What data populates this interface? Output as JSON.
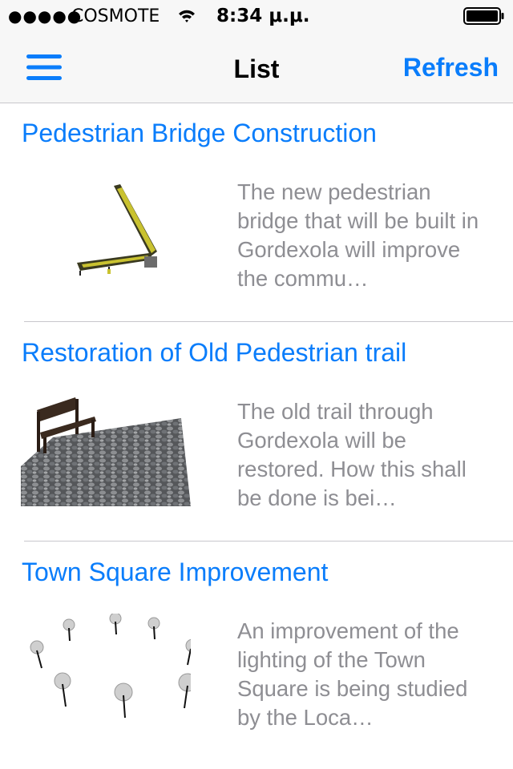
{
  "status_bar": {
    "signal": "●●●●●",
    "carrier": "COSMOTE",
    "time": "8:34 μ.μ."
  },
  "nav": {
    "title": "List",
    "refresh_label": "Refresh"
  },
  "items": [
    {
      "title": "Pedestrian Bridge Construction",
      "description": "The new pedestrian bridge that will be built in Gordexola will improve the commu…"
    },
    {
      "title": "Restoration of Old Pedestrian trail",
      "description": "The old trail through Gordexola will be restored. How this shall  be done is bei…"
    },
    {
      "title": "Town Square Improvement",
      "description": "An improvement of the lighting of the Town Square is being studied by the Loca…"
    }
  ],
  "colors": {
    "accent": "#0a7dfb",
    "description_text": "#8e8e93",
    "bar_background": "#f7f7f7"
  }
}
